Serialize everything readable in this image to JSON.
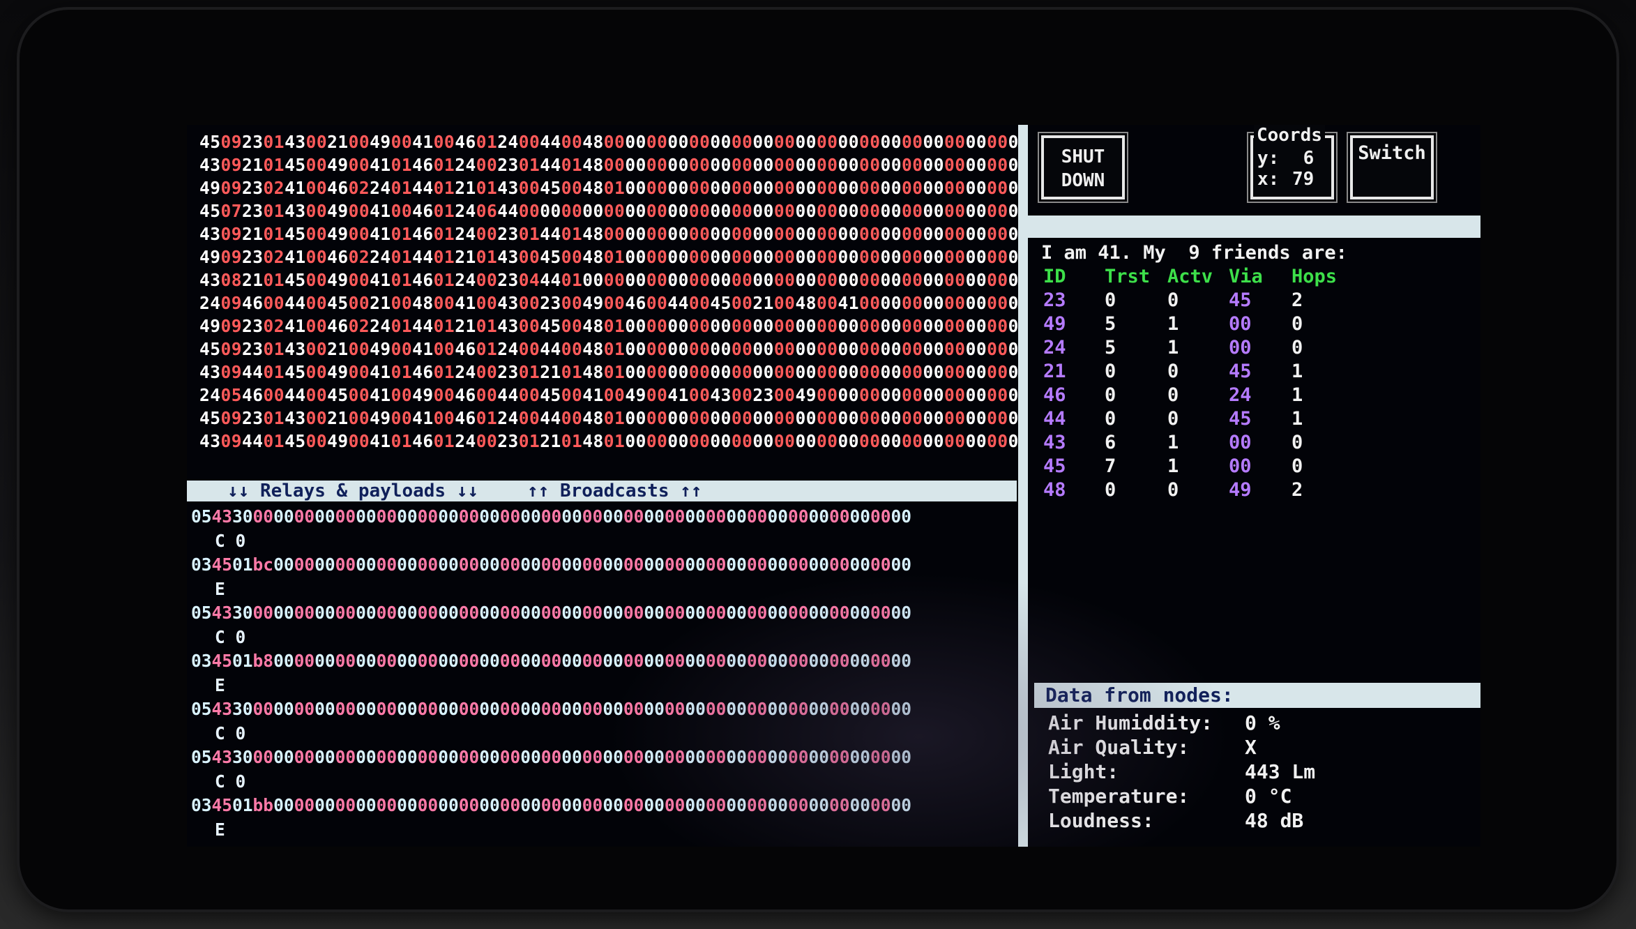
{
  "colors": {
    "hex_white": "#ffffff",
    "hex_red": "#ff5a5a",
    "relay_cyan": "#d9f3ff",
    "relay_pink": "#ff7aa8",
    "relay_brown": "#ff6aa0",
    "bar_bg": "#d8e6ea",
    "bar_text": "#10205a",
    "table_header_green": "#3de04a",
    "table_purple": "#b57bff"
  },
  "hex_dump": [
    [
      "45",
      "09",
      "23",
      "01",
      "43",
      "00",
      "21",
      "00",
      "49",
      "00",
      "41",
      "00",
      "46",
      "01",
      "24",
      "00",
      "44",
      "00",
      "48",
      "00",
      "00",
      "00",
      "00",
      "00",
      "00",
      "00",
      "00",
      "00",
      "00",
      "00",
      "00",
      "00",
      "00",
      "00",
      "00",
      "00",
      "00",
      "00",
      "00",
      "00"
    ],
    [
      "43",
      "09",
      "21",
      "01",
      "45",
      "00",
      "49",
      "00",
      "41",
      "01",
      "46",
      "01",
      "24",
      "00",
      "23",
      "01",
      "44",
      "01",
      "48",
      "00",
      "00",
      "00",
      "00",
      "00",
      "00",
      "00",
      "00",
      "00",
      "00",
      "00",
      "00",
      "00",
      "00",
      "00",
      "00",
      "00",
      "00",
      "00",
      "00",
      "00"
    ],
    [
      "49",
      "09",
      "23",
      "02",
      "41",
      "00",
      "46",
      "02",
      "24",
      "01",
      "44",
      "01",
      "21",
      "01",
      "43",
      "00",
      "45",
      "00",
      "48",
      "01",
      "00",
      "00",
      "00",
      "00",
      "00",
      "00",
      "00",
      "00",
      "00",
      "00",
      "00",
      "00",
      "00",
      "00",
      "00",
      "00",
      "00",
      "00",
      "00",
      "00"
    ],
    [
      "45",
      "07",
      "23",
      "01",
      "43",
      "00",
      "49",
      "00",
      "41",
      "00",
      "46",
      "01",
      "24",
      "06",
      "44",
      "00",
      "00",
      "00",
      "00",
      "00",
      "00",
      "00",
      "00",
      "00",
      "00",
      "00",
      "00",
      "00",
      "00",
      "00",
      "00",
      "00",
      "00",
      "00",
      "00",
      "00",
      "00",
      "00",
      "00",
      "00"
    ],
    [
      "43",
      "09",
      "21",
      "01",
      "45",
      "00",
      "49",
      "00",
      "41",
      "01",
      "46",
      "01",
      "24",
      "00",
      "23",
      "01",
      "44",
      "01",
      "48",
      "00",
      "00",
      "00",
      "00",
      "00",
      "00",
      "00",
      "00",
      "00",
      "00",
      "00",
      "00",
      "00",
      "00",
      "00",
      "00",
      "00",
      "00",
      "00",
      "00",
      "00"
    ],
    [
      "49",
      "09",
      "23",
      "02",
      "41",
      "00",
      "46",
      "02",
      "24",
      "01",
      "44",
      "01",
      "21",
      "01",
      "43",
      "00",
      "45",
      "00",
      "48",
      "01",
      "00",
      "00",
      "00",
      "00",
      "00",
      "00",
      "00",
      "00",
      "00",
      "00",
      "00",
      "00",
      "00",
      "00",
      "00",
      "00",
      "00",
      "00",
      "00",
      "00"
    ],
    [
      "43",
      "08",
      "21",
      "01",
      "45",
      "00",
      "49",
      "00",
      "41",
      "01",
      "46",
      "01",
      "24",
      "00",
      "23",
      "04",
      "44",
      "01",
      "00",
      "00",
      "00",
      "00",
      "00",
      "00",
      "00",
      "00",
      "00",
      "00",
      "00",
      "00",
      "00",
      "00",
      "00",
      "00",
      "00",
      "00",
      "00",
      "00",
      "00",
      "00"
    ],
    [
      "24",
      "09",
      "46",
      "00",
      "44",
      "00",
      "45",
      "00",
      "21",
      "00",
      "48",
      "00",
      "41",
      "00",
      "43",
      "00",
      "23",
      "00",
      "49",
      "00",
      "46",
      "00",
      "44",
      "00",
      "45",
      "00",
      "21",
      "00",
      "48",
      "00",
      "41",
      "00",
      "00",
      "00",
      "00",
      "00",
      "00",
      "00",
      "00",
      "00"
    ],
    [
      "49",
      "09",
      "23",
      "02",
      "41",
      "00",
      "46",
      "02",
      "24",
      "01",
      "44",
      "01",
      "21",
      "01",
      "43",
      "00",
      "45",
      "00",
      "48",
      "01",
      "00",
      "00",
      "00",
      "00",
      "00",
      "00",
      "00",
      "00",
      "00",
      "00",
      "00",
      "00",
      "00",
      "00",
      "00",
      "00",
      "00",
      "00",
      "00",
      "00"
    ],
    [
      "45",
      "09",
      "23",
      "01",
      "43",
      "00",
      "21",
      "00",
      "49",
      "00",
      "41",
      "00",
      "46",
      "01",
      "24",
      "00",
      "44",
      "00",
      "48",
      "01",
      "00",
      "00",
      "00",
      "00",
      "00",
      "00",
      "00",
      "00",
      "00",
      "00",
      "00",
      "00",
      "00",
      "00",
      "00",
      "00",
      "00",
      "00",
      "00",
      "00"
    ],
    [
      "43",
      "09",
      "44",
      "01",
      "45",
      "00",
      "49",
      "00",
      "41",
      "01",
      "46",
      "01",
      "24",
      "00",
      "23",
      "01",
      "21",
      "01",
      "48",
      "01",
      "00",
      "00",
      "00",
      "00",
      "00",
      "00",
      "00",
      "00",
      "00",
      "00",
      "00",
      "00",
      "00",
      "00",
      "00",
      "00",
      "00",
      "00",
      "00",
      "00"
    ],
    [
      "24",
      "05",
      "46",
      "00",
      "44",
      "00",
      "45",
      "00",
      "41",
      "00",
      "49",
      "00",
      "46",
      "00",
      "44",
      "00",
      "45",
      "00",
      "41",
      "00",
      "49",
      "00",
      "41",
      "00",
      "43",
      "00",
      "23",
      "00",
      "49",
      "00",
      "00",
      "00",
      "00",
      "00",
      "00",
      "00",
      "00",
      "00",
      "00",
      "00"
    ],
    [
      "45",
      "09",
      "23",
      "01",
      "43",
      "00",
      "21",
      "00",
      "49",
      "00",
      "41",
      "00",
      "46",
      "01",
      "24",
      "00",
      "44",
      "00",
      "48",
      "01",
      "00",
      "00",
      "00",
      "00",
      "00",
      "00",
      "00",
      "00",
      "00",
      "00",
      "00",
      "00",
      "00",
      "00",
      "00",
      "00",
      "00",
      "00",
      "00",
      "00"
    ],
    [
      "43",
      "09",
      "44",
      "01",
      "45",
      "00",
      "49",
      "00",
      "41",
      "01",
      "46",
      "01",
      "24",
      "00",
      "23",
      "01",
      "21",
      "01",
      "48",
      "01",
      "00",
      "00",
      "00",
      "00",
      "00",
      "00",
      "00",
      "00",
      "00",
      "00",
      "00",
      "00",
      "00",
      "00",
      "00",
      "00",
      "00",
      "00",
      "00",
      "00"
    ]
  ],
  "relay_bar": {
    "left_label": "↓↓ Relays & payloads ↓↓",
    "right_label": "↑↑ Broadcasts ↑↑"
  },
  "relay_log": [
    {
      "line": [
        "05",
        "43",
        "30",
        "00",
        "00",
        "00",
        "00",
        "00",
        "00",
        "00",
        "00",
        "00",
        "00",
        "00",
        "00",
        "00",
        "00",
        "00",
        "00",
        "00",
        "00",
        "00",
        "00",
        "00",
        "00",
        "00",
        "00",
        "00",
        "00",
        "00",
        "00",
        "00",
        "00",
        "00",
        "00"
      ],
      "sub": "C 0"
    },
    {
      "line": [
        "03",
        "45",
        "01",
        "bc",
        "00",
        "00",
        "00",
        "00",
        "00",
        "00",
        "00",
        "00",
        "00",
        "00",
        "00",
        "00",
        "00",
        "00",
        "00",
        "00",
        "00",
        "00",
        "00",
        "00",
        "00",
        "00",
        "00",
        "00",
        "00",
        "00",
        "00",
        "00",
        "00",
        "00",
        "00"
      ],
      "sub": "E"
    },
    {
      "line": [
        "05",
        "43",
        "30",
        "00",
        "00",
        "00",
        "00",
        "00",
        "00",
        "00",
        "00",
        "00",
        "00",
        "00",
        "00",
        "00",
        "00",
        "00",
        "00",
        "00",
        "00",
        "00",
        "00",
        "00",
        "00",
        "00",
        "00",
        "00",
        "00",
        "00",
        "00",
        "00",
        "00",
        "00",
        "00"
      ],
      "sub": "C 0"
    },
    {
      "line": [
        "03",
        "45",
        "01",
        "b8",
        "00",
        "00",
        "00",
        "00",
        "00",
        "00",
        "00",
        "00",
        "00",
        "00",
        "00",
        "00",
        "00",
        "00",
        "00",
        "00",
        "00",
        "00",
        "00",
        "00",
        "00",
        "00",
        "00",
        "00",
        "00",
        "00",
        "00",
        "00",
        "00",
        "00",
        "00"
      ],
      "sub": "E"
    },
    {
      "line": [
        "05",
        "43",
        "30",
        "00",
        "00",
        "00",
        "00",
        "00",
        "00",
        "00",
        "00",
        "00",
        "00",
        "00",
        "00",
        "00",
        "00",
        "00",
        "00",
        "00",
        "00",
        "00",
        "00",
        "00",
        "00",
        "00",
        "00",
        "00",
        "00",
        "00",
        "00",
        "00",
        "00",
        "00",
        "00"
      ],
      "sub": "C 0"
    },
    {
      "line": [
        "05",
        "43",
        "30",
        "00",
        "00",
        "00",
        "00",
        "00",
        "00",
        "00",
        "00",
        "00",
        "00",
        "00",
        "00",
        "00",
        "00",
        "00",
        "00",
        "00",
        "00",
        "00",
        "00",
        "00",
        "00",
        "00",
        "00",
        "00",
        "00",
        "00",
        "00",
        "00",
        "00",
        "00",
        "00"
      ],
      "sub": "C 0"
    },
    {
      "line": [
        "03",
        "45",
        "01",
        "bb",
        "00",
        "00",
        "00",
        "00",
        "00",
        "00",
        "00",
        "00",
        "00",
        "00",
        "00",
        "00",
        "00",
        "00",
        "00",
        "00",
        "00",
        "00",
        "00",
        "00",
        "00",
        "00",
        "00",
        "00",
        "00",
        "00",
        "00",
        "00",
        "00",
        "00",
        "00"
      ],
      "sub": "E"
    }
  ],
  "buttons": {
    "shutdown_line1": "SHUT",
    "shutdown_line2": "DOWN",
    "switch": "Switch"
  },
  "coords": {
    "title": "Coords",
    "y_label": "y:",
    "y_value": "6",
    "x_label": "x:",
    "x_value": "79"
  },
  "friends": {
    "title": "I am 41. My  9 friends are:",
    "headers": [
      "ID",
      "Trst",
      "Actv",
      "Via",
      "Hops"
    ],
    "rows": [
      [
        "23",
        "0",
        "0",
        "45",
        "2"
      ],
      [
        "49",
        "5",
        "1",
        "00",
        "0"
      ],
      [
        "24",
        "5",
        "1",
        "00",
        "0"
      ],
      [
        "21",
        "0",
        "0",
        "45",
        "1"
      ],
      [
        "46",
        "0",
        "0",
        "24",
        "1"
      ],
      [
        "44",
        "0",
        "0",
        "45",
        "1"
      ],
      [
        "43",
        "6",
        "1",
        "00",
        "0"
      ],
      [
        "45",
        "7",
        "1",
        "00",
        "0"
      ],
      [
        "48",
        "0",
        "0",
        "49",
        "2"
      ]
    ]
  },
  "sensors": {
    "title": "Data from nodes:",
    "rows": [
      {
        "label": "Air Humiddity:",
        "value": "0 %"
      },
      {
        "label": "Air Quality:",
        "value": "X"
      },
      {
        "label": "Light:",
        "value": "443 Lm"
      },
      {
        "label": "Temperature:",
        "value": "0 °C"
      },
      {
        "label": "Loudness:",
        "value": "48 dB"
      }
    ]
  }
}
